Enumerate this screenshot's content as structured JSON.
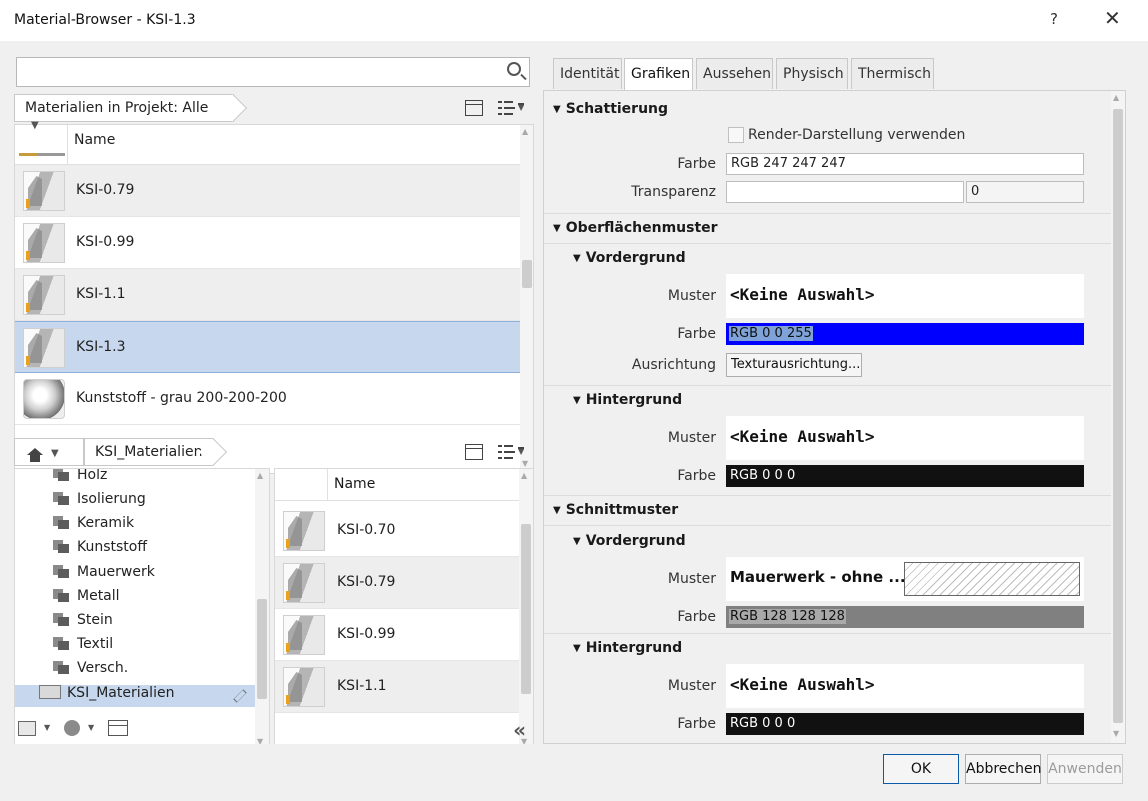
{
  "window": {
    "title": "Material-Browser - KSI-1.3",
    "help": "?",
    "close": "✕"
  },
  "search": {
    "value": "",
    "placeholder": ""
  },
  "filter": {
    "label": "Materialien in Projekt: Alle"
  },
  "project_list": {
    "column_name": "Name",
    "items": [
      {
        "label": "KSI-0.79",
        "thumb": "wall"
      },
      {
        "label": "KSI-0.99",
        "thumb": "wall"
      },
      {
        "label": "KSI-1.1",
        "thumb": "wall"
      },
      {
        "label": "KSI-1.3",
        "thumb": "wall",
        "selected": true
      },
      {
        "label": "Kunststoff - grau 200-200-200",
        "thumb": "sphere"
      }
    ]
  },
  "library_bar": {
    "label": "KSI_Materialien"
  },
  "library_tree": {
    "items": [
      "Holz",
      "Isolierung",
      "Keramik",
      "Kunststoff",
      "Mauerwerk",
      "Metall",
      "Stein",
      "Textil",
      "Versch."
    ],
    "selected": "KSI_Materialien"
  },
  "library_list": {
    "column_name": "Name",
    "items": [
      "KSI-0.70",
      "KSI-0.79",
      "KSI-0.99",
      "KSI-1.1"
    ]
  },
  "tabs": [
    {
      "label": "Identität"
    },
    {
      "label": "Grafiken",
      "active": true
    },
    {
      "label": "Aussehen"
    },
    {
      "label": "Physisch"
    },
    {
      "label": "Thermisch"
    }
  ],
  "schattierung": {
    "title": "Schattierung",
    "render_checkbox_label": "Render-Darstellung verwenden",
    "render_checked": false,
    "farbe_label": "Farbe",
    "farbe_value": "RGB 247 247 247",
    "transparenz_label": "Transparenz",
    "transparenz_value": "0",
    "transparenz_slider": 0
  },
  "oberflaeche": {
    "title": "Oberflächenmuster",
    "vordergrund": {
      "title": "Vordergrund",
      "muster_label": "Muster",
      "muster_value": "<Keine Auswahl>",
      "farbe_label": "Farbe",
      "farbe_value": "RGB 0 0 255",
      "farbe_color": "#0000ff",
      "ausrichtung_label": "Ausrichtung",
      "ausrichtung_button": "Texturausrichtung..."
    },
    "hintergrund": {
      "title": "Hintergrund",
      "muster_label": "Muster",
      "muster_value": "<Keine Auswahl>",
      "farbe_label": "Farbe",
      "farbe_value": "RGB 0 0 0",
      "farbe_color": "#000000"
    }
  },
  "schnitt": {
    "title": "Schnittmuster",
    "vordergrund": {
      "title": "Vordergrund",
      "muster_label": "Muster",
      "muster_value": "Mauerwerk - ohne ...",
      "farbe_label": "Farbe",
      "farbe_value": "RGB 128 128 128",
      "farbe_color": "#808080"
    },
    "hintergrund": {
      "title": "Hintergrund",
      "muster_label": "Muster",
      "muster_value": "<Keine Auswahl>",
      "farbe_label": "Farbe",
      "farbe_value": "RGB 0 0 0",
      "farbe_color": "#000000"
    }
  },
  "footer": {
    "ok": "OK",
    "cancel": "Abbrechen",
    "apply": "Anwenden"
  }
}
